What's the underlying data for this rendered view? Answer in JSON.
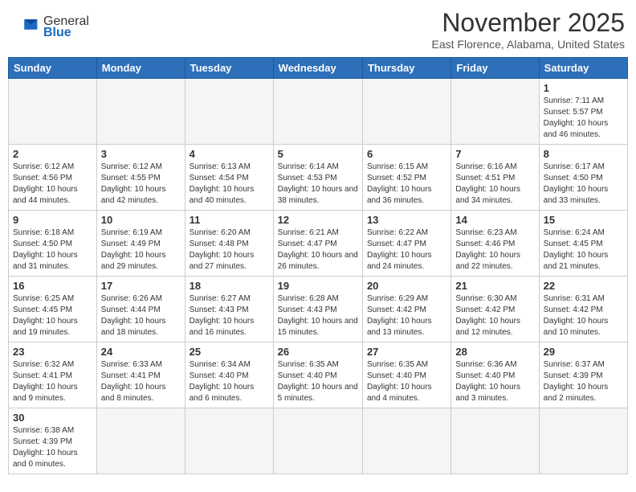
{
  "header": {
    "logo_general": "General",
    "logo_blue": "Blue",
    "month": "November 2025",
    "location": "East Florence, Alabama, United States"
  },
  "days_of_week": [
    "Sunday",
    "Monday",
    "Tuesday",
    "Wednesday",
    "Thursday",
    "Friday",
    "Saturday"
  ],
  "weeks": [
    [
      {
        "day": "",
        "info": ""
      },
      {
        "day": "",
        "info": ""
      },
      {
        "day": "",
        "info": ""
      },
      {
        "day": "",
        "info": ""
      },
      {
        "day": "",
        "info": ""
      },
      {
        "day": "",
        "info": ""
      },
      {
        "day": "1",
        "info": "Sunrise: 7:11 AM\nSunset: 5:57 PM\nDaylight: 10 hours and 46 minutes."
      }
    ],
    [
      {
        "day": "2",
        "info": "Sunrise: 6:12 AM\nSunset: 4:56 PM\nDaylight: 10 hours and 44 minutes."
      },
      {
        "day": "3",
        "info": "Sunrise: 6:12 AM\nSunset: 4:55 PM\nDaylight: 10 hours and 42 minutes."
      },
      {
        "day": "4",
        "info": "Sunrise: 6:13 AM\nSunset: 4:54 PM\nDaylight: 10 hours and 40 minutes."
      },
      {
        "day": "5",
        "info": "Sunrise: 6:14 AM\nSunset: 4:53 PM\nDaylight: 10 hours and 38 minutes."
      },
      {
        "day": "6",
        "info": "Sunrise: 6:15 AM\nSunset: 4:52 PM\nDaylight: 10 hours and 36 minutes."
      },
      {
        "day": "7",
        "info": "Sunrise: 6:16 AM\nSunset: 4:51 PM\nDaylight: 10 hours and 34 minutes."
      },
      {
        "day": "8",
        "info": "Sunrise: 6:17 AM\nSunset: 4:50 PM\nDaylight: 10 hours and 33 minutes."
      }
    ],
    [
      {
        "day": "9",
        "info": "Sunrise: 6:18 AM\nSunset: 4:50 PM\nDaylight: 10 hours and 31 minutes."
      },
      {
        "day": "10",
        "info": "Sunrise: 6:19 AM\nSunset: 4:49 PM\nDaylight: 10 hours and 29 minutes."
      },
      {
        "day": "11",
        "info": "Sunrise: 6:20 AM\nSunset: 4:48 PM\nDaylight: 10 hours and 27 minutes."
      },
      {
        "day": "12",
        "info": "Sunrise: 6:21 AM\nSunset: 4:47 PM\nDaylight: 10 hours and 26 minutes."
      },
      {
        "day": "13",
        "info": "Sunrise: 6:22 AM\nSunset: 4:47 PM\nDaylight: 10 hours and 24 minutes."
      },
      {
        "day": "14",
        "info": "Sunrise: 6:23 AM\nSunset: 4:46 PM\nDaylight: 10 hours and 22 minutes."
      },
      {
        "day": "15",
        "info": "Sunrise: 6:24 AM\nSunset: 4:45 PM\nDaylight: 10 hours and 21 minutes."
      }
    ],
    [
      {
        "day": "16",
        "info": "Sunrise: 6:25 AM\nSunset: 4:45 PM\nDaylight: 10 hours and 19 minutes."
      },
      {
        "day": "17",
        "info": "Sunrise: 6:26 AM\nSunset: 4:44 PM\nDaylight: 10 hours and 18 minutes."
      },
      {
        "day": "18",
        "info": "Sunrise: 6:27 AM\nSunset: 4:43 PM\nDaylight: 10 hours and 16 minutes."
      },
      {
        "day": "19",
        "info": "Sunrise: 6:28 AM\nSunset: 4:43 PM\nDaylight: 10 hours and 15 minutes."
      },
      {
        "day": "20",
        "info": "Sunrise: 6:29 AM\nSunset: 4:42 PM\nDaylight: 10 hours and 13 minutes."
      },
      {
        "day": "21",
        "info": "Sunrise: 6:30 AM\nSunset: 4:42 PM\nDaylight: 10 hours and 12 minutes."
      },
      {
        "day": "22",
        "info": "Sunrise: 6:31 AM\nSunset: 4:42 PM\nDaylight: 10 hours and 10 minutes."
      }
    ],
    [
      {
        "day": "23",
        "info": "Sunrise: 6:32 AM\nSunset: 4:41 PM\nDaylight: 10 hours and 9 minutes."
      },
      {
        "day": "24",
        "info": "Sunrise: 6:33 AM\nSunset: 4:41 PM\nDaylight: 10 hours and 8 minutes."
      },
      {
        "day": "25",
        "info": "Sunrise: 6:34 AM\nSunset: 4:40 PM\nDaylight: 10 hours and 6 minutes."
      },
      {
        "day": "26",
        "info": "Sunrise: 6:35 AM\nSunset: 4:40 PM\nDaylight: 10 hours and 5 minutes."
      },
      {
        "day": "27",
        "info": "Sunrise: 6:35 AM\nSunset: 4:40 PM\nDaylight: 10 hours and 4 minutes."
      },
      {
        "day": "28",
        "info": "Sunrise: 6:36 AM\nSunset: 4:40 PM\nDaylight: 10 hours and 3 minutes."
      },
      {
        "day": "29",
        "info": "Sunrise: 6:37 AM\nSunset: 4:39 PM\nDaylight: 10 hours and 2 minutes."
      }
    ],
    [
      {
        "day": "30",
        "info": "Sunrise: 6:38 AM\nSunset: 4:39 PM\nDaylight: 10 hours and 0 minutes."
      },
      {
        "day": "",
        "info": ""
      },
      {
        "day": "",
        "info": ""
      },
      {
        "day": "",
        "info": ""
      },
      {
        "day": "",
        "info": ""
      },
      {
        "day": "",
        "info": ""
      },
      {
        "day": "",
        "info": ""
      }
    ]
  ]
}
